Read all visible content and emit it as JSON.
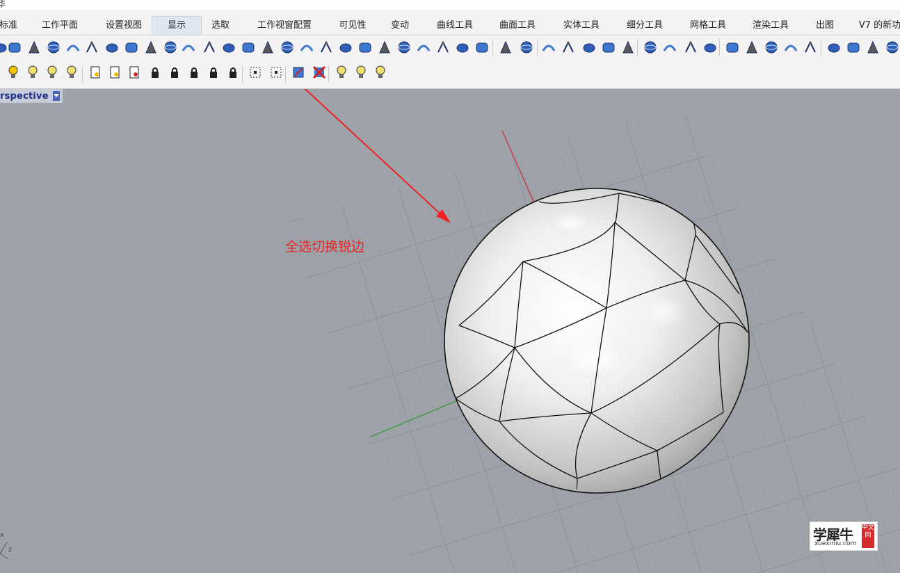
{
  "app": {
    "partial_title": "华"
  },
  "tabs": [
    {
      "label": "标准",
      "active": false
    },
    {
      "label": "工作平面",
      "active": false
    },
    {
      "label": "设置视图",
      "active": false
    },
    {
      "label": "显示",
      "active": true
    },
    {
      "label": "选取",
      "active": false
    },
    {
      "label": "工作视窗配置",
      "active": false
    },
    {
      "label": "可见性",
      "active": false
    },
    {
      "label": "变动",
      "active": false
    },
    {
      "label": "曲线工具",
      "active": false
    },
    {
      "label": "曲面工具",
      "active": false
    },
    {
      "label": "实体工具",
      "active": false
    },
    {
      "label": "细分工具",
      "active": false
    },
    {
      "label": "网格工具",
      "active": false
    },
    {
      "label": "渲染工具",
      "active": false
    },
    {
      "label": "出图",
      "active": false
    },
    {
      "label": "V7 的新功",
      "active": false
    }
  ],
  "viewport": {
    "label": "rspective"
  },
  "annotation": {
    "text": "全选切换锐边"
  },
  "watermark": {
    "title": "学犀牛",
    "subtitle": "xuexiniu.com",
    "seal": "中文网"
  },
  "axis_labels": {
    "x": "x",
    "z": "z"
  },
  "colors": {
    "accent": "#4b63b8",
    "annotation": "#ee2222",
    "viewport_bg": "#9ea2a9",
    "x_axis": "#c43a3a",
    "y_axis": "#3a9a3a"
  },
  "icons_row1": [
    "subd-pill-icon",
    "subd-box-icon",
    "subd-cone-icon",
    "subd-truncated-cone-icon",
    "subd-cylinder-icon",
    "subd-sphere-icon",
    "subd-ellipsoid-icon",
    "subd-torus-icon",
    "subd-box-cage-icon",
    "subd-single-face-icon",
    "subd-loft-icon",
    "subd-sweep1-icon",
    "subd-sweep2-icon",
    "subd-branch-icon",
    "subd-extrude-icon",
    "subd-offset-icon",
    "subd-bridge-icon",
    "subd-slide-icon",
    "subd-crease-icon",
    "subd-fill-icon",
    "subd-merge-icon",
    "subd-stitch-icon",
    "subd-weld-icon",
    "subd-insert-edge-icon",
    "subd-poke-icon",
    "subd-bevel-icon",
    "subd-cap-icon",
    "subd-symmetry-icon",
    "subd-mirror-icon",
    "subd-remove-crease-icon",
    "subd-display-toggle-icon",
    "subd-fit-curve-icon",
    "subd-patch-icon",
    "subd-convert-icon",
    "subd-mesh-icon",
    "subd-mesh-options-icon",
    "subd-repair-icon",
    "subd-settings-icon",
    "subd-box-mode-icon",
    "subd-smooth-mode-icon",
    "subd-reflect-icon",
    "subd-pipe-icon",
    "subd-paint-icon",
    "subd-gumball-icon",
    "subd-select-filter-icon",
    "subd-point-filter-icon",
    "subd-help-icon"
  ],
  "icons_row2": [
    "light-bulb-icon",
    "light-bulb-add-icon",
    "light-bulb-swap-icon",
    "light-bulb-select-icon",
    "layer-page-icon",
    "layer-page-on-icon",
    "layer-page-off-icon",
    "lock-icon",
    "unlock-icon",
    "lock-all-icon",
    "unlock-selected-icon",
    "swap-lock-icon",
    "select-points-icon",
    "select-edges-icon",
    "toggle-sharp-icon",
    "remove-sharp-icon",
    "light-on-icon",
    "light-off-icon",
    "light-all-icon"
  ]
}
